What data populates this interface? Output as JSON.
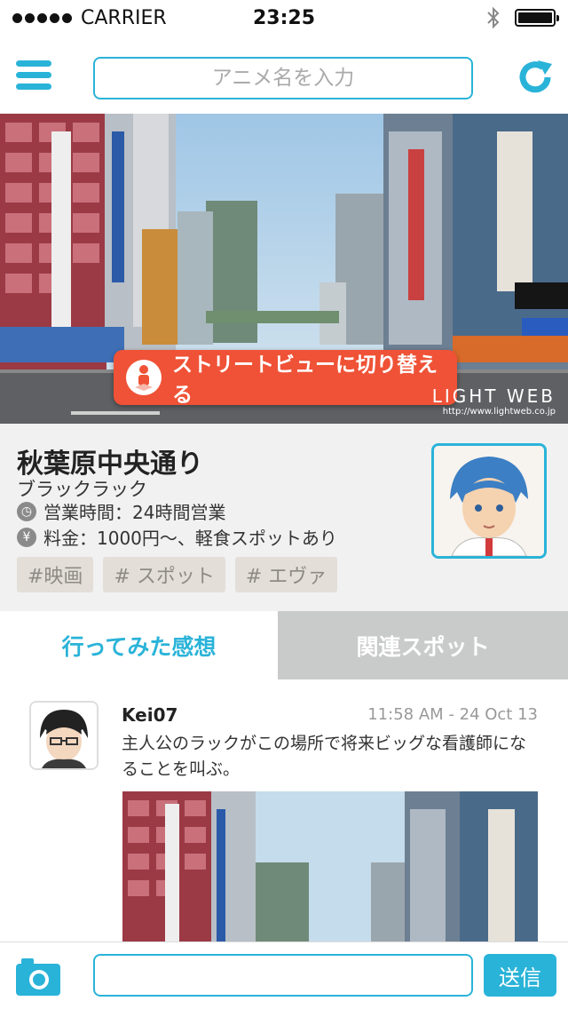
{
  "status_bar": {
    "carrier": "CARRIER",
    "time": "23:25"
  },
  "header": {
    "search_placeholder": "アニメ名を入力"
  },
  "hero": {
    "streetview_label": "ストリートビューに切り替える",
    "watermark_brand": "LIGHT WEB",
    "watermark_url": "http://www.lightweb.co.jp"
  },
  "spot": {
    "title": "秋葉原中央通り",
    "subtitle": "ブラックラック",
    "hours": "営業時間：24時間営業",
    "price": "料金：1000円〜、軽食スポットあり",
    "tags": [
      "#映画",
      "# スポット",
      "# エヴァ"
    ]
  },
  "tabs": [
    {
      "label": "行ってみた感想",
      "active": true
    },
    {
      "label": "関連スポット",
      "active": false
    }
  ],
  "comment": {
    "username": "Kei07",
    "timestamp": "11:58 AM - 24 Oct 13",
    "text": "主人公のラックがこの場所で将来ビッグな看護師になることを叫ぶ。"
  },
  "footer": {
    "send_label": "送信"
  },
  "colors": {
    "accent": "#2ab3d8",
    "streetview": "#ef5236",
    "tag_bg": "#e3ded8",
    "inactive_tab": "#c9caca"
  }
}
